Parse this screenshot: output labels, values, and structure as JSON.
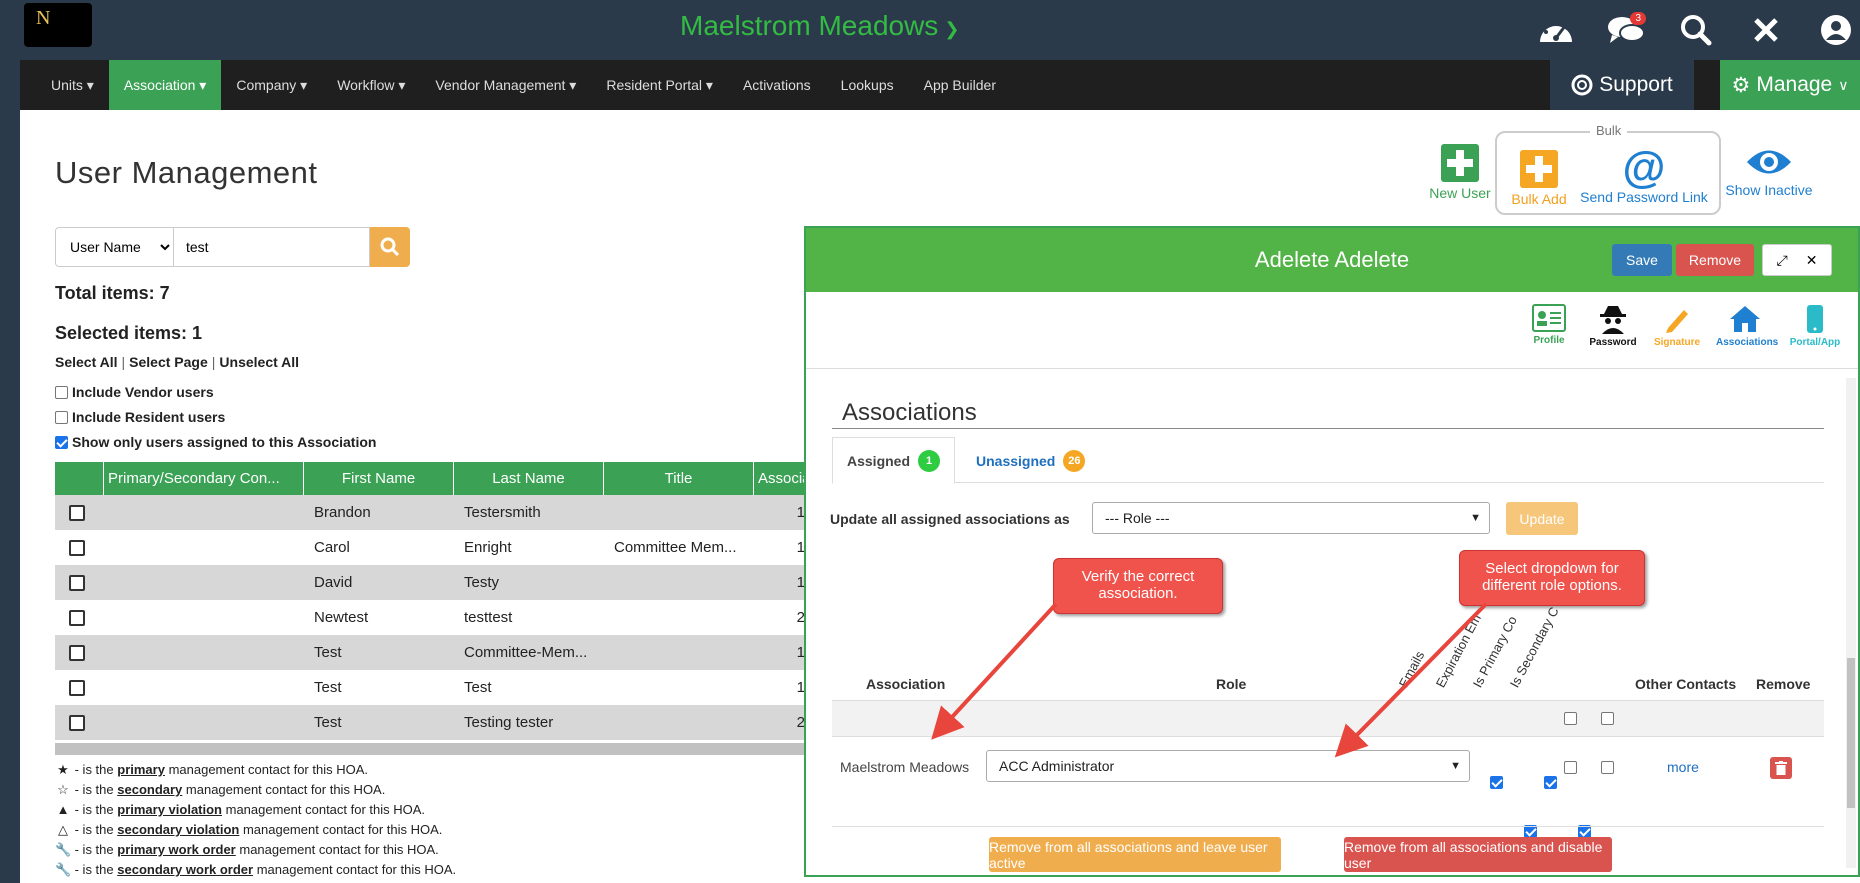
{
  "brand": {
    "logo_text": "N",
    "site_name": "Maelstrom Meadows",
    "notification_count": "3"
  },
  "nav": {
    "items": [
      "Units",
      "Association",
      "Company",
      "Workflow",
      "Vendor Management",
      "Resident Portal",
      "Activations",
      "Lookups",
      "App Builder"
    ],
    "active": "Association",
    "support_label": "Support",
    "manage_label": "Manage"
  },
  "page": {
    "title": "User Management",
    "search_field": "User Name",
    "search_value": "test",
    "total_items": "Total items: 7",
    "selected_items": "Selected items: 1",
    "select_all": "Select All",
    "select_page": "Select Page",
    "unselect_all": "Unselect All",
    "sep": "|",
    "include_vendor": "Include Vendor users",
    "include_resident": "Include Resident users",
    "show_only_assigned": "Show only users assigned to this Association"
  },
  "toolbar": {
    "new_user": "New User",
    "bulk": "Bulk",
    "bulk_add": "Bulk Add",
    "send_password_link": "Send Password Link",
    "show_inactive": "Show Inactive"
  },
  "grid": {
    "columns": [
      "Primary/Secondary Con...",
      "First Name",
      "Last Name",
      "Title",
      "Associa"
    ],
    "rows": [
      {
        "first": "Brandon",
        "last": "Testersmith",
        "title": "",
        "assoc": "1"
      },
      {
        "first": "Carol",
        "last": "Enright",
        "title": "Committee Mem...",
        "assoc": "1"
      },
      {
        "first": "David",
        "last": "Testy",
        "title": "",
        "assoc": "1"
      },
      {
        "first": "Newtest",
        "last": "testtest",
        "title": "",
        "assoc": "2"
      },
      {
        "first": "Test",
        "last": "Committee-Mem...",
        "title": "",
        "assoc": "1"
      },
      {
        "first": "Test",
        "last": "Test",
        "title": "",
        "assoc": "1"
      },
      {
        "first": "Test",
        "last": "Testing tester",
        "title": "",
        "assoc": "2"
      }
    ]
  },
  "legend": [
    {
      "pre": " - is the ",
      "key": "primary",
      "post": " management contact for this HOA."
    },
    {
      "pre": " - is the ",
      "key": "secondary",
      "post": " management contact for this HOA."
    },
    {
      "pre": " - is the ",
      "key": "primary violation",
      "post": " management contact for this HOA."
    },
    {
      "pre": " - is the ",
      "key": "secondary violation",
      "post": " management contact for this HOA."
    },
    {
      "pre": " - is the ",
      "key": "primary work order",
      "post": " management contact for this HOA."
    },
    {
      "pre": " - is the ",
      "key": "secondary work order",
      "post": " management contact for this HOA."
    }
  ],
  "modal": {
    "title": "Adelete Adelete",
    "save": "Save",
    "remove": "Remove",
    "tabs": [
      "Profile",
      "Password",
      "Signature",
      "Associations",
      "Portal/App"
    ],
    "section_title": "Associations",
    "assigned_label": "Assigned",
    "assigned_count": "1",
    "unassigned_label": "Unassigned",
    "unassigned_count": "26",
    "update_label": "Update all assigned associations as",
    "role_placeholder": "--- Role ---",
    "update_btn": "Update",
    "col_association": "Association",
    "col_role": "Role",
    "col_emails": "Emails",
    "col_expiration": "Expiration Em",
    "col_primary": "Is Primary Co",
    "col_secondary": "Is Secondary C",
    "col_other": "Other Contacts",
    "col_remove": "Remove",
    "row_assoc": "Maelstrom Meadows",
    "row_role": "ACC Administrator",
    "more": "more",
    "btn_leave_active": "Remove from all associations and leave user active",
    "btn_disable": "Remove from all associations and disable user",
    "callout1": "Verify the correct association.",
    "callout2": "Select dropdown for different role options."
  },
  "colors": {
    "green": "#3ba255",
    "header": "#2b3a4a",
    "orange": "#f0ad4e",
    "blue": "#337ab7",
    "red": "#d9534f"
  }
}
